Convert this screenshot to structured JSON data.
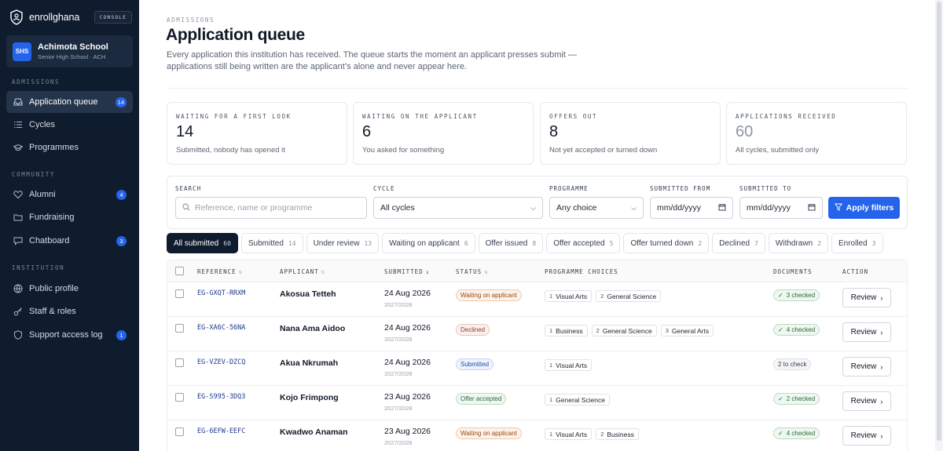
{
  "app": {
    "name": "enrollghana",
    "console_label": "CONSOLE"
  },
  "school": {
    "avatar": "SHS",
    "name": "Achimota School",
    "subtitle": "Senior High School · ACH"
  },
  "sidebar": {
    "sections": [
      {
        "label": "ADMISSIONS",
        "items": [
          {
            "label": "Application queue",
            "icon": "inbox-icon",
            "count": "14",
            "active": true
          },
          {
            "label": "Cycles",
            "icon": "list-icon",
            "count": null,
            "active": false
          },
          {
            "label": "Programmes",
            "icon": "graduation-cap-icon",
            "count": null,
            "active": false
          }
        ]
      },
      {
        "label": "COMMUNITY",
        "items": [
          {
            "label": "Alumni",
            "icon": "heart-icon",
            "count": "4",
            "active": false
          },
          {
            "label": "Fundraising",
            "icon": "folder-icon",
            "count": null,
            "active": false
          },
          {
            "label": "Chatboard",
            "icon": "chat-icon",
            "count": "3",
            "active": false
          }
        ]
      },
      {
        "label": "INSTITUTION",
        "items": [
          {
            "label": "Public profile",
            "icon": "globe-icon",
            "count": null,
            "active": false
          },
          {
            "label": "Staff & roles",
            "icon": "key-icon",
            "count": null,
            "active": false
          },
          {
            "label": "Support access log",
            "icon": "shield-icon",
            "count": "1",
            "active": false
          }
        ]
      }
    ]
  },
  "header": {
    "eyebrow": "ADMISSIONS",
    "title": "Application queue",
    "description": "Every application this institution has received. The queue starts the moment an applicant presses submit — applications still being written are the applicant’s alone and never appear here."
  },
  "stats": [
    {
      "label": "WAITING FOR A FIRST LOOK",
      "value": "14",
      "sub": "Submitted, nobody has opened it",
      "muted": false
    },
    {
      "label": "WAITING ON THE APPLICANT",
      "value": "6",
      "sub": "You asked for something",
      "muted": false
    },
    {
      "label": "OFFERS OUT",
      "value": "8",
      "sub": "Not yet accepted or turned down",
      "muted": false
    },
    {
      "label": "APPLICATIONS RECEIVED",
      "value": "60",
      "sub": "All cycles, submitted only",
      "muted": true
    }
  ],
  "filters": {
    "search_label": "SEARCH",
    "search_placeholder": "Reference, name or programme",
    "cycle_label": "CYCLE",
    "cycle_value": "All cycles",
    "programme_label": "PROGRAMME",
    "programme_value": "Any choice",
    "from_label": "SUBMITTED FROM",
    "from_value": "mm/dd/yyyy",
    "to_label": "SUBMITTED TO",
    "to_value": "mm/dd/yyyy",
    "apply_label": "Apply filters"
  },
  "tabs": [
    {
      "label": "All submitted",
      "count": "60",
      "active": true
    },
    {
      "label": "Submitted",
      "count": "14",
      "active": false
    },
    {
      "label": "Under review",
      "count": "13",
      "active": false
    },
    {
      "label": "Waiting on applicant",
      "count": "6",
      "active": false
    },
    {
      "label": "Offer issued",
      "count": "8",
      "active": false
    },
    {
      "label": "Offer accepted",
      "count": "5",
      "active": false
    },
    {
      "label": "Offer turned down",
      "count": "2",
      "active": false
    },
    {
      "label": "Declined",
      "count": "7",
      "active": false
    },
    {
      "label": "Withdrawn",
      "count": "2",
      "active": false
    },
    {
      "label": "Enrolled",
      "count": "3",
      "active": false
    }
  ],
  "table": {
    "columns": {
      "reference": "REFERENCE",
      "applicant": "APPLICANT",
      "submitted": "SUBMITTED",
      "status": "STATUS",
      "choices": "PROGRAMME CHOICES",
      "documents": "DOCUMENTS",
      "action": "ACTION"
    },
    "rows": [
      {
        "reference": "EG-GXQT-RRXM",
        "applicant": "Akosua Tetteh",
        "date": "24 Aug 2026",
        "cycle": "2027/2028",
        "status": "Waiting on applicant",
        "status_kind": "wait",
        "choices": [
          {
            "n": "1",
            "name": "Visual Arts"
          },
          {
            "n": "2",
            "name": "General Science"
          }
        ],
        "documents": "3 checked",
        "docs_ok": true,
        "action": "Review"
      },
      {
        "reference": "EG-XA6C-56NA",
        "applicant": "Nana Ama Aidoo",
        "date": "24 Aug 2026",
        "cycle": "2027/2028",
        "status": "Declined",
        "status_kind": "dec",
        "choices": [
          {
            "n": "1",
            "name": "Business"
          },
          {
            "n": "2",
            "name": "General Science"
          },
          {
            "n": "3",
            "name": "General Arts"
          }
        ],
        "documents": "4 checked",
        "docs_ok": true,
        "action": "Review"
      },
      {
        "reference": "EG-VZEV-DZCQ",
        "applicant": "Akua Nkrumah",
        "date": "24 Aug 2026",
        "cycle": "2027/2028",
        "status": "Submitted",
        "status_kind": "sub",
        "choices": [
          {
            "n": "1",
            "name": "Visual Arts"
          }
        ],
        "documents": "2 to check",
        "docs_ok": false,
        "action": "Review"
      },
      {
        "reference": "EG-S995-3DQ3",
        "applicant": "Kojo Frimpong",
        "date": "23 Aug 2026",
        "cycle": "2027/2028",
        "status": "Offer accepted",
        "status_kind": "acc",
        "choices": [
          {
            "n": "1",
            "name": "General Science"
          }
        ],
        "documents": "2 checked",
        "docs_ok": true,
        "action": "Review"
      },
      {
        "reference": "EG-6EFW-EEFC",
        "applicant": "Kwadwo Anaman",
        "date": "23 Aug 2026",
        "cycle": "2027/2028",
        "status": "Waiting on applicant",
        "status_kind": "wait",
        "choices": [
          {
            "n": "1",
            "name": "Visual Arts"
          },
          {
            "n": "2",
            "name": "Business"
          }
        ],
        "documents": "4 checked",
        "docs_ok": true,
        "action": "Review"
      }
    ]
  }
}
